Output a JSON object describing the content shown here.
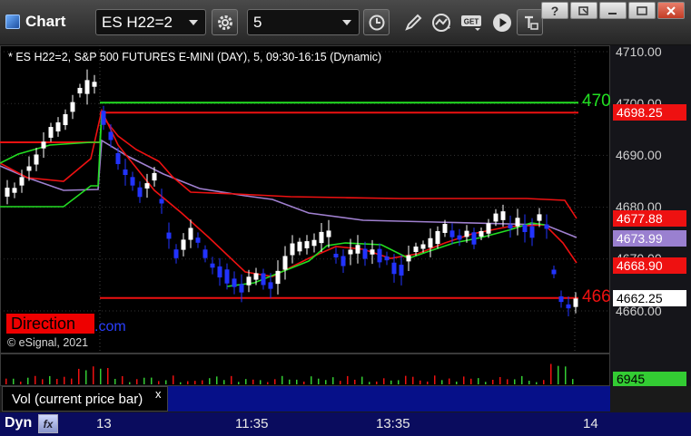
{
  "toolbar": {
    "title": "Chart",
    "symbol": "ES H22=2",
    "interval": "5",
    "icons": [
      "settings-gear-icon",
      "clock-icon",
      "pencil-icon",
      "study-icon",
      "get-icon",
      "play-icon",
      "text-icon"
    ],
    "window_buttons": [
      "?",
      "restore",
      "minimize",
      "close"
    ]
  },
  "chart": {
    "description": "* ES H22=2, S&P 500 FUTURES E-MINI (DAY), 5, 09:30-16:15 (Dynamic)",
    "direction_badge": "Direction",
    "badge_suffix": ".com",
    "copyright": "© eSignal, 2021",
    "line_label_upper": "470",
    "line_label_lower": "466",
    "price_ticks": [
      "4710.00",
      "4700.00",
      "4690.00",
      "4680.00",
      "4670.00",
      "4660.00"
    ],
    "price_tags": {
      "upper_resistance": "4698.25",
      "ma_upper": "4677.88",
      "ma_mid": "4673.99",
      "ma_lower": "4668.90",
      "last_price": "4662.25"
    },
    "colors": {
      "up": "#ffffff",
      "down": "#2233ff",
      "red_line": "#ee1111",
      "green_line": "#22dd22",
      "purple_line": "#a080d0",
      "tag_red": "#ee1111",
      "tag_purple": "#9a80d0"
    }
  },
  "volume": {
    "label": "Vol (current price bar)",
    "close_glyph": "x",
    "value": "6945"
  },
  "time_axis": {
    "dyn_label": "Dyn",
    "labels": [
      "13",
      "11:35",
      "13:35",
      "14"
    ]
  },
  "chart_data": {
    "type": "candlestick",
    "title": "* ES H22=2, S&P 500 FUTURES E-MINI (DAY), 5, 09:30-16:15 (Dynamic)",
    "ylim": [
      4653.5,
      4712.5
    ],
    "y_ticks": [
      4710,
      4700,
      4690,
      4680,
      4670,
      4660
    ],
    "x_tick_labels": [
      "13",
      "11:35",
      "13:35",
      "14"
    ],
    "horizontal_levels": [
      {
        "value": 4698.25,
        "color": "red"
      },
      {
        "value": 4700.0,
        "color": "green"
      },
      {
        "value": 4662.5,
        "color": "red"
      }
    ],
    "last_price": 4662.25,
    "last_volume": 6945
  }
}
